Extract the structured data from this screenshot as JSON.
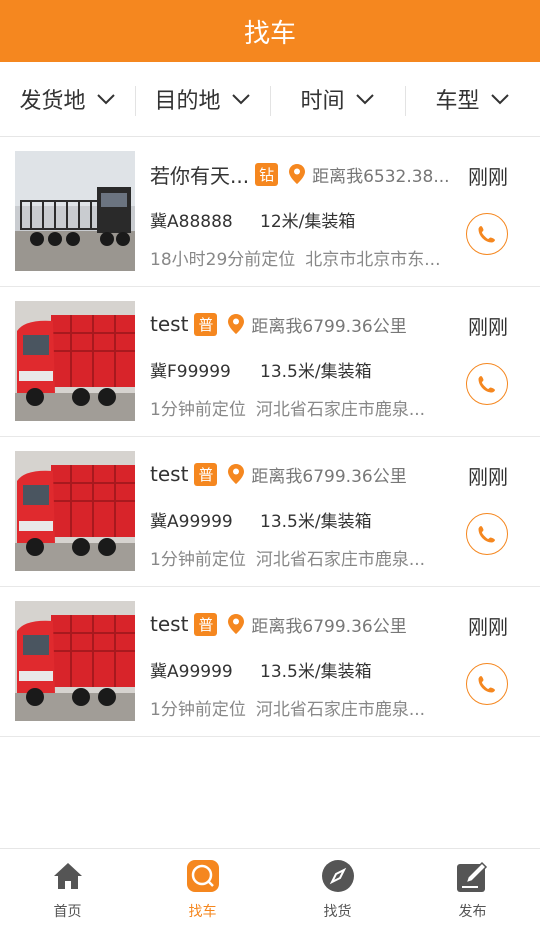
{
  "header": {
    "title": "找车"
  },
  "filters": [
    {
      "label": "发货地"
    },
    {
      "label": "目的地"
    },
    {
      "label": "时间"
    },
    {
      "label": "车型"
    }
  ],
  "trucks": [
    {
      "name": "若你有天...",
      "badge": "钻",
      "distance": "距离我6532.38...",
      "time_ago": "刚刚",
      "plate": "冀A88888",
      "spec": "12米/集装箱",
      "located": "18小时29分前定位",
      "location": "北京市北京市东...",
      "photo": "dark-trailer"
    },
    {
      "name": "test",
      "badge": "普",
      "distance": "距离我6799.36公里",
      "time_ago": "刚刚",
      "plate": "冀F99999",
      "spec": "13.5米/集装箱",
      "located": "1分钟前定位",
      "location": "河北省石家庄市鹿泉...",
      "photo": "red-truck"
    },
    {
      "name": "test",
      "badge": "普",
      "distance": "距离我6799.36公里",
      "time_ago": "刚刚",
      "plate": "冀A99999",
      "spec": "13.5米/集装箱",
      "located": "1分钟前定位",
      "location": "河北省石家庄市鹿泉...",
      "photo": "red-truck"
    },
    {
      "name": "test",
      "badge": "普",
      "distance": "距离我6799.36公里",
      "time_ago": "刚刚",
      "plate": "冀A99999",
      "spec": "13.5米/集装箱",
      "located": "1分钟前定位",
      "location": "河北省石家庄市鹿泉...",
      "photo": "red-truck"
    }
  ],
  "tabbar": [
    {
      "label": "首页",
      "icon": "home-icon",
      "active": false
    },
    {
      "label": "找车",
      "icon": "find-truck-icon",
      "active": true
    },
    {
      "label": "找货",
      "icon": "compass-icon",
      "active": false
    },
    {
      "label": "发布",
      "icon": "edit-icon",
      "active": false
    }
  ],
  "colors": {
    "accent": "#f5871f",
    "header_text": "#ffffff"
  }
}
